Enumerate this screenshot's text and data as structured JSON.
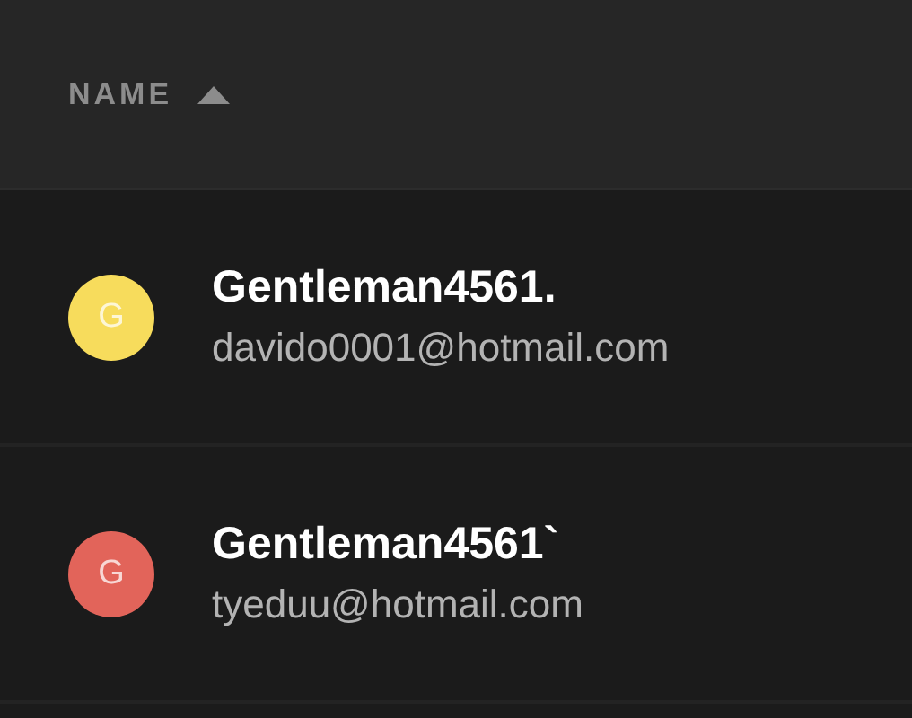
{
  "table": {
    "columns": [
      {
        "label": "NAME",
        "sort_ascending": true
      }
    ],
    "rows": [
      {
        "initial": "G",
        "color": "#f7dc5c",
        "name": "Gentleman4561.",
        "email": "davido0001@hotmail.com"
      },
      {
        "initial": "G",
        "color": "#e2645a",
        "name": "Gentleman4561`",
        "email": "tyeduu@hotmail.com"
      }
    ]
  }
}
